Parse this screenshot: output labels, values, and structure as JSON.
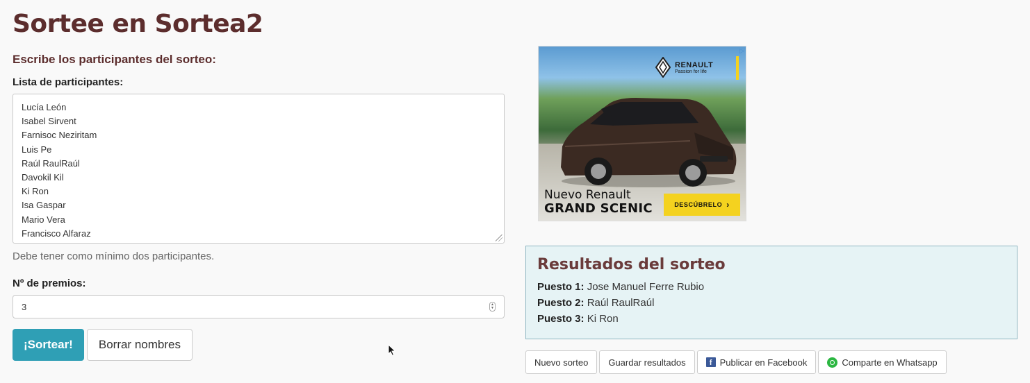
{
  "page": {
    "title": "Sortee en Sortea2"
  },
  "form": {
    "subtitle": "Escribe los participantes del sorteo:",
    "participants_label": "Lista de participantes:",
    "participants": [
      "Lucía León",
      "Isabel Sirvent",
      "Farnisoc Neziritam",
      "Luis Pe",
      "Raúl RaulRaúl",
      "Davokil Kil",
      "Ki Ron",
      "Isa Gaspar",
      "Mario Vera",
      "Francisco Alfaraz"
    ],
    "help_text": "Debe tener como mínimo dos participantes.",
    "prizes_label": "Nº de premios:",
    "prizes_value": "3",
    "draw_button": "¡Sortear!",
    "clear_button": "Borrar nombres"
  },
  "ad": {
    "brand": "RENAULT",
    "tagline": "Passion for life",
    "headline_line1": "Nuevo Renault",
    "headline_line2": "GRAND SCENIC",
    "cta": "DESCÚBRELO",
    "cta_arrow": "›",
    "adchoices_glyph": "▷",
    "accent_color": "#f4d21f"
  },
  "results": {
    "title": "Resultados del sorteo",
    "entries": [
      {
        "position": "Puesto 1:",
        "name": "Jose Manuel Ferre Rubio"
      },
      {
        "position": "Puesto 2:",
        "name": "Raúl RaulRaúl"
      },
      {
        "position": "Puesto 3:",
        "name": "Ki Ron"
      }
    ]
  },
  "actions": {
    "new_draw": "Nuevo sorteo",
    "save_results": "Guardar resultados",
    "publish_facebook": "Publicar en Facebook",
    "share_whatsapp": "Comparte en Whatsapp",
    "facebook_icon": "facebook-icon",
    "whatsapp_icon": "whatsapp-icon"
  },
  "colors": {
    "title": "#5c2d2d",
    "primary_button": "#2f9fb5",
    "results_bg": "#e6f3f5",
    "facebook": "#3b5998",
    "whatsapp": "#2cb742"
  }
}
